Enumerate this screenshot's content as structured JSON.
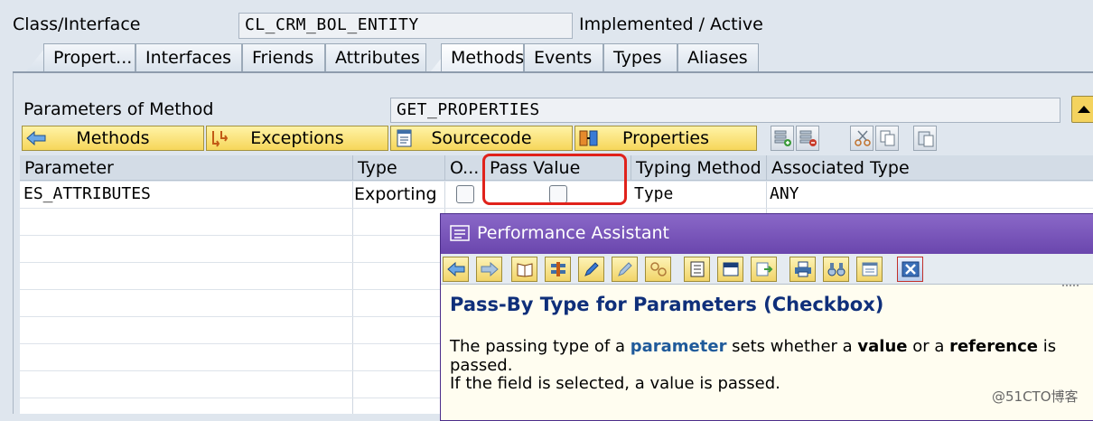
{
  "header": {
    "class_label": "Class/Interface",
    "class_value": "CL_CRM_BOL_ENTITY",
    "status": "Implemented / Active"
  },
  "tabs": [
    {
      "label": "Propert...",
      "active": false
    },
    {
      "label": "Interfaces",
      "active": false
    },
    {
      "label": "Friends",
      "active": false
    },
    {
      "label": "Attributes",
      "active": false
    },
    {
      "label": "Methods",
      "active": true
    },
    {
      "label": "Events",
      "active": false
    },
    {
      "label": "Types",
      "active": false
    },
    {
      "label": "Aliases",
      "active": false
    }
  ],
  "params": {
    "label": "Parameters of Method",
    "value": "GET_PROPERTIES"
  },
  "nav_buttons": {
    "methods": "Methods",
    "exceptions": "Exceptions",
    "sourcecode": "Sourcecode",
    "properties": "Properties"
  },
  "table": {
    "headers": {
      "parameter": "Parameter",
      "type": "Type",
      "optional": "O...",
      "pass_value": "Pass Value",
      "typing_method": "Typing Method",
      "associated_type": "Associated Type"
    },
    "rows": [
      {
        "parameter": "ES_ATTRIBUTES",
        "type": "Exporting",
        "optional": false,
        "pass_value": false,
        "typing_method": "Type",
        "associated_type": "ANY"
      }
    ]
  },
  "assistant": {
    "title": "Performance Assistant",
    "heading": "Pass-By Type for Parameters (Checkbox)",
    "p1_a": "The passing type of a ",
    "p1_link": "parameter",
    "p1_b": " sets whether a ",
    "p1_value": "value",
    "p1_c": " or a ",
    "p1_ref": "reference",
    "p1_d": " is passed.",
    "p2": "If the field is selected, a value is passed."
  },
  "watermark": "@51CTO博客"
}
